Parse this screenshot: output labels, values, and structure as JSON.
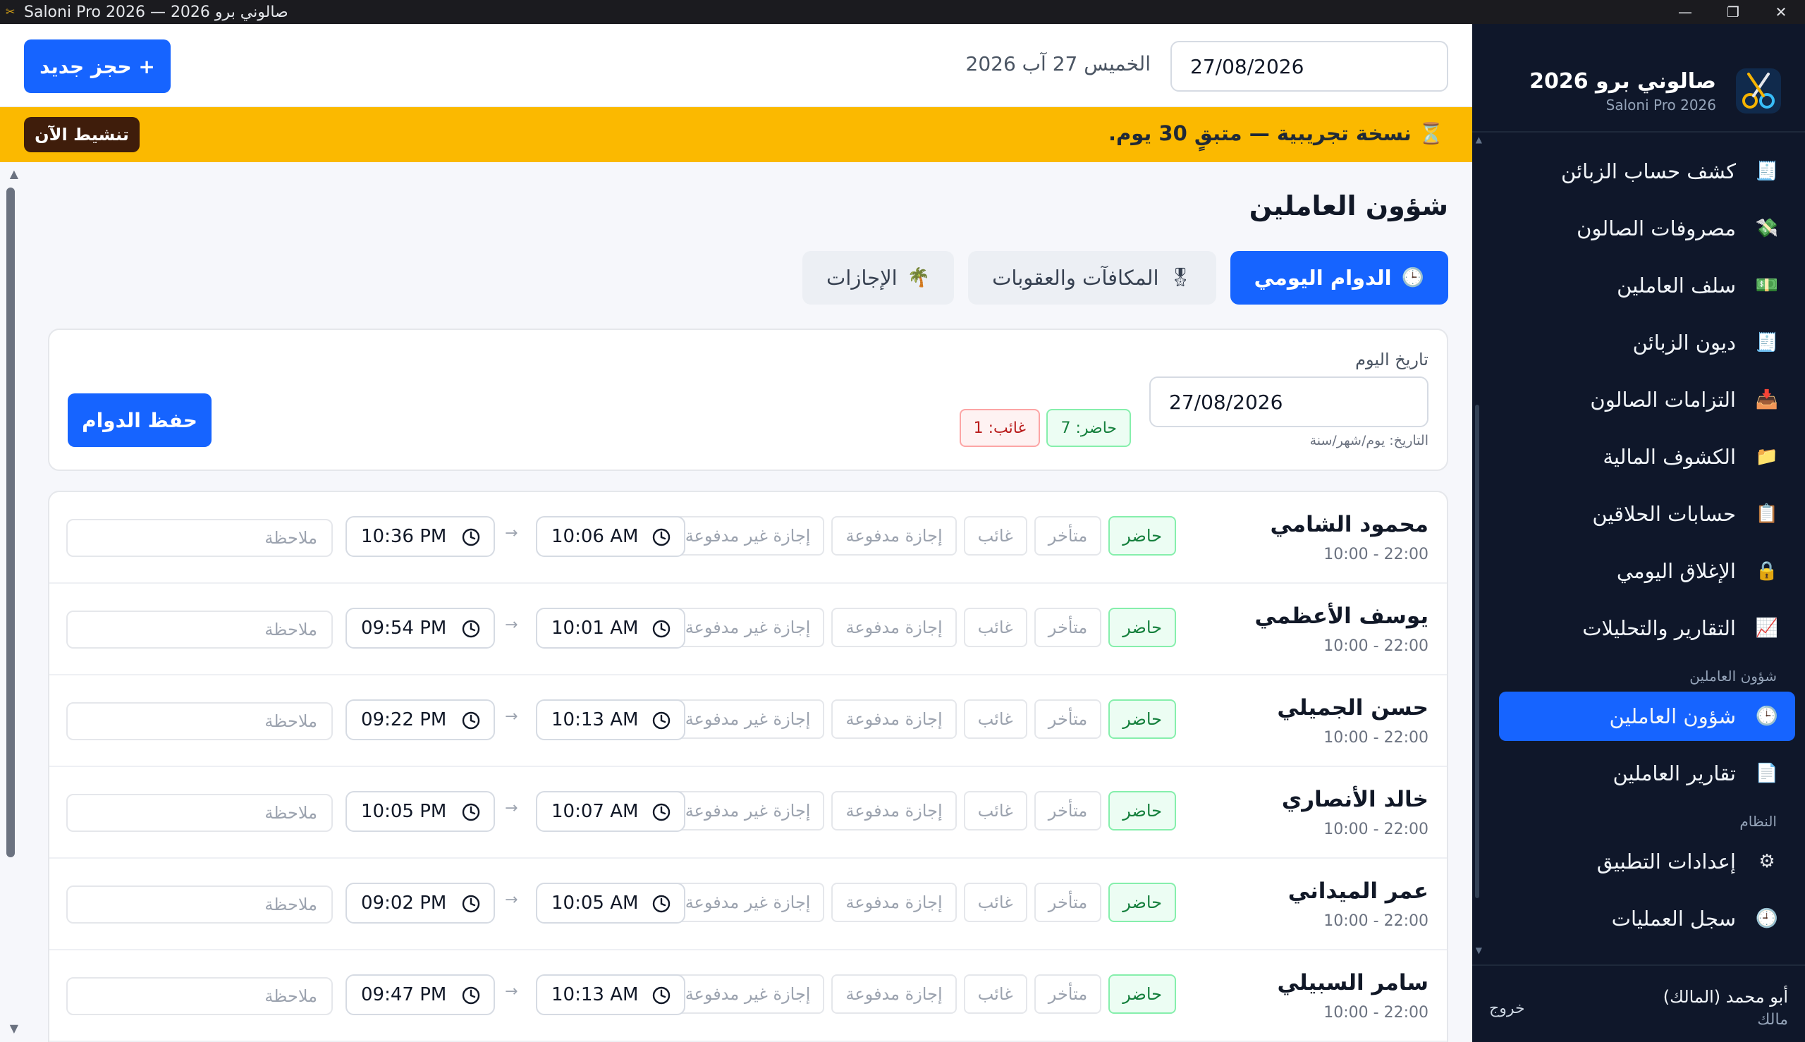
{
  "window": {
    "title": "Saloni Pro 2026 — صالوني برو 2026",
    "minimize": "—",
    "maximize": "❐",
    "close": "✕"
  },
  "sidebar": {
    "brand_name": "صالوني برو 2026",
    "brand_sub": "Saloni Pro 2026",
    "items_top": [
      {
        "label": "كشف حساب الزبائن",
        "icon": "client-statement-icon",
        "glyph": "🧾"
      },
      {
        "label": "مصروفات الصالون",
        "icon": "money-wings-icon",
        "glyph": "💸"
      },
      {
        "label": "سلف العاملين",
        "icon": "cash-icon",
        "glyph": "💵"
      },
      {
        "label": "ديون الزبائن",
        "icon": "receipt-icon",
        "glyph": "🧾"
      },
      {
        "label": "التزامات الصالون",
        "icon": "inbox-icon",
        "glyph": "📥"
      },
      {
        "label": "الكشوف المالية",
        "icon": "folder-icon",
        "glyph": "📁"
      },
      {
        "label": "حسابات الحلاقين",
        "icon": "clipboard-icon",
        "glyph": "📋"
      },
      {
        "label": "الإغلاق اليومي",
        "icon": "lock-icon",
        "glyph": "🔒"
      },
      {
        "label": "التقارير والتحليلات",
        "icon": "chart-icon",
        "glyph": "📈"
      }
    ],
    "section_workers": "شؤون العاملين",
    "items_workers": [
      {
        "label": "شؤون العاملين",
        "icon": "clock-icon",
        "glyph": "🕒",
        "active": true
      },
      {
        "label": "تقارير العاملين",
        "icon": "document-icon",
        "glyph": "📄"
      }
    ],
    "section_system": "النظام",
    "items_system": [
      {
        "label": "إعدادات التطبيق",
        "icon": "gear-icon",
        "glyph": "⚙"
      },
      {
        "label": "سجل العمليات",
        "icon": "history-icon",
        "glyph": "🕘"
      }
    ],
    "user_name": "أبو محمد (المالك)",
    "user_role": "مالك",
    "logout": "خروج"
  },
  "topbar": {
    "date_value": "27/08/2026",
    "today_label": "الخميس 27 آب 2026",
    "new_booking": "+ حجز جديد"
  },
  "banner": {
    "text": "⏳ نسخة تجريبية — متبقٍ 30 يوم.",
    "activate": "تنشيط الآن"
  },
  "page": {
    "title": "شؤون العاملين",
    "tabs": [
      {
        "label": "الدوام اليومي",
        "icon": "clock-icon",
        "glyph": "🕒",
        "active": true
      },
      {
        "label": "المكافآت والعقوبات",
        "icon": "medal-icon",
        "glyph": "🎖"
      },
      {
        "label": "الإجازات",
        "icon": "palm-tree-icon",
        "glyph": "🌴"
      }
    ],
    "filter": {
      "label": "تاريخ اليوم",
      "date": "27/08/2026",
      "hint": "التاريخ: يوم/شهر/سنة",
      "present": "حاضر: 7",
      "absent": "غائب: 1",
      "save": "حفظ الدوام"
    },
    "status_options": [
      "حاضر",
      "متأخر",
      "غائب",
      "إجازة مدفوعة",
      "إجازة غير مدفوعة"
    ],
    "note_placeholder": "ملاحظة",
    "arrow": "→",
    "rows": [
      {
        "name": "محمود الشامي",
        "shift": "10:00 - 22:00",
        "in": "10:06 AM",
        "out": "10:36 PM",
        "status": "حاضر"
      },
      {
        "name": "يوسف الأعظمي",
        "shift": "10:00 - 22:00",
        "in": "10:01 AM",
        "out": "09:54 PM",
        "status": "حاضر"
      },
      {
        "name": "حسن الجميلي",
        "shift": "10:00 - 22:00",
        "in": "10:13 AM",
        "out": "09:22 PM",
        "status": "حاضر"
      },
      {
        "name": "خالد الأنصاري",
        "shift": "10:00 - 22:00",
        "in": "10:07 AM",
        "out": "10:05 PM",
        "status": "حاضر"
      },
      {
        "name": "عمر الميداني",
        "shift": "10:00 - 22:00",
        "in": "10:05 AM",
        "out": "09:02 PM",
        "status": "حاضر"
      },
      {
        "name": "سامر السبيلي",
        "shift": "10:00 - 22:00",
        "in": "10:13 AM",
        "out": "09:47 PM",
        "status": "حاضر"
      }
    ]
  },
  "colors": {
    "accent": "#1664ff",
    "sidebar_bg": "#0f172a",
    "banner": "#fbb900",
    "present_green": "#15803d",
    "absent_red": "#b91c1c"
  }
}
